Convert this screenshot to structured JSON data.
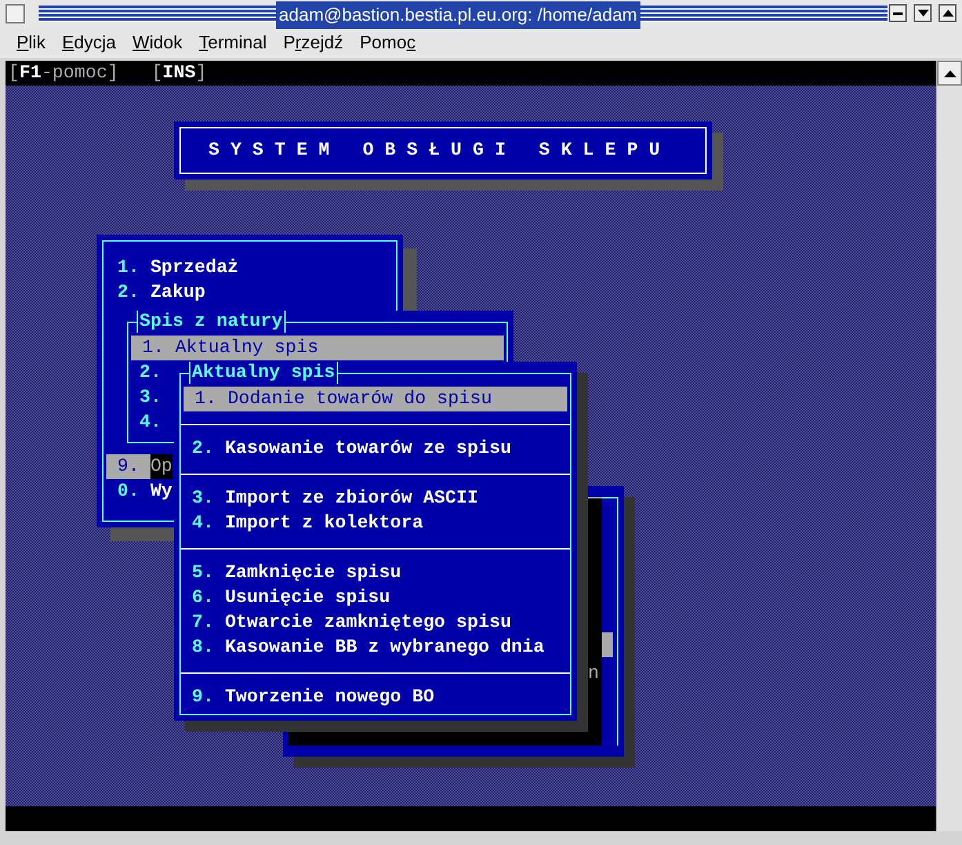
{
  "window": {
    "title": "adam@bastion.bestia.pl.eu.org: /home/adam"
  },
  "menu_bar": [
    {
      "mnemonic": "P",
      "rest": "lik"
    },
    {
      "mnemonic": "E",
      "rest": "dycja"
    },
    {
      "mnemonic": "W",
      "rest": "idok"
    },
    {
      "mnemonic": "T",
      "rest": "erminal"
    },
    {
      "before": "P",
      "mnemonic": "r",
      "rest": "zejdź"
    },
    {
      "before": "Pomo",
      "mnemonic": "c"
    }
  ],
  "status_line": [
    "[**F1**-pomoc]",
    "[**INS**]"
  ],
  "header": "S Y S T E M   O B S Ł U G I   S K L E P U",
  "main_menu": {
    "items": [
      {
        "number": "1.",
        "label": "Sprzedaż",
        "selected": false
      },
      {
        "number": "2.",
        "label": "Zakup",
        "selected": false
      },
      {
        "number": "9.",
        "label": "Op",
        "selected": true
      },
      {
        "number": "0.",
        "label": "Wy",
        "selected": false
      }
    ]
  },
  "spis_menu": {
    "title": "Spis z natury",
    "items": [
      {
        "number": "1.",
        "label": "Aktualny spis",
        "selected": true
      },
      {
        "number": "2.",
        "selected": false
      },
      {
        "number": "3.",
        "selected": false
      },
      {
        "number": "4.",
        "selected": false
      }
    ]
  },
  "back_window": {
    "text": "n"
  },
  "aktualny_menu": {
    "title": "Aktualny spis",
    "items": [
      {
        "kind": "item",
        "number": "1.",
        "label": "Dodanie towarów do spisu",
        "selected": true
      },
      {
        "kind": "separator"
      },
      {
        "kind": "item",
        "number": "2.",
        "label": "Kasowanie towarów ze spisu",
        "selected": false
      },
      {
        "kind": "separator"
      },
      {
        "kind": "item",
        "number": "3.",
        "label": "Import ze zbiorów ASCII",
        "selected": false
      },
      {
        "kind": "item",
        "number": "4.",
        "label": "Import z kolektora",
        "selected": false
      },
      {
        "kind": "separator"
      },
      {
        "kind": "item",
        "number": "5.",
        "label": "Zamknięcie spisu",
        "selected": false
      },
      {
        "kind": "item",
        "number": "6.",
        "label": "Usunięcie spisu",
        "selected": false
      },
      {
        "kind": "item",
        "number": "7.",
        "label": "Otwarcie zamkniętego spisu",
        "selected": false
      },
      {
        "kind": "item",
        "number": "8.",
        "label": "Kasowanie BB z wybranego dnia",
        "selected": false
      },
      {
        "kind": "separator"
      },
      {
        "kind": "item",
        "number": "9.",
        "label": "Tworzenie nowego BO",
        "selected": false
      }
    ]
  }
}
